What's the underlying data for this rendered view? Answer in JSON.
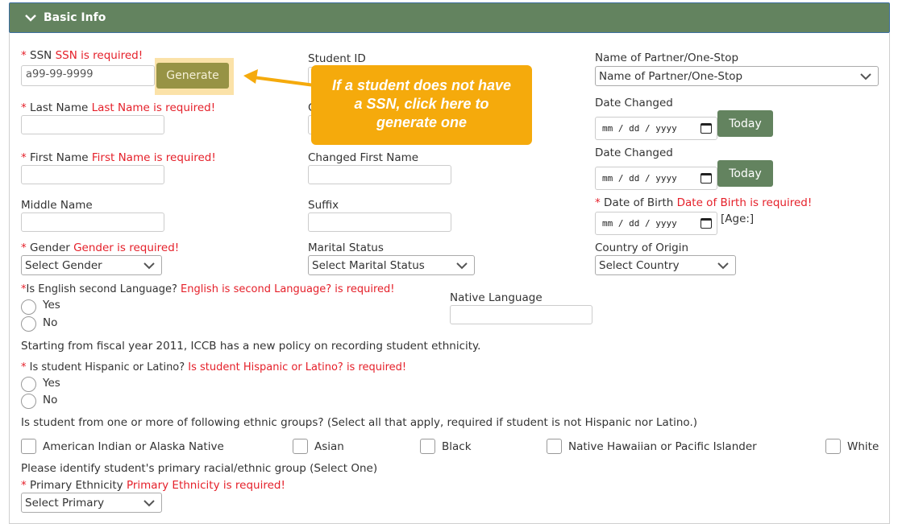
{
  "panel": {
    "title": "Basic Info",
    "icon": "chevron-down-icon"
  },
  "ssn": {
    "star": "* ",
    "label": "SSN ",
    "error": "SSN is required!",
    "value": "a99-99-9999",
    "generate_label": "Generate"
  },
  "callout": {
    "line1": "If a student does not have",
    "line2": "a SSN, click here to",
    "line3": "generate one"
  },
  "student_id": {
    "label": "Student ID",
    "value": ""
  },
  "changed_last_name": {
    "label": "C",
    "value": ""
  },
  "partner": {
    "label": "Name of Partner/One-Stop",
    "selected": "Name of Partner/One-Stop"
  },
  "date_changed_1": {
    "label": "Date Changed",
    "placeholder": "mm / dd / yyyy",
    "today_label": "Today"
  },
  "date_changed_2": {
    "label": "Date Changed",
    "placeholder": "mm / dd / yyyy",
    "today_label": "Today"
  },
  "last_name": {
    "star": "* ",
    "label": "Last Name ",
    "error": "Last Name is required!",
    "value": ""
  },
  "first_name": {
    "star": "* ",
    "label": "First Name ",
    "error": "First Name is required!",
    "value": ""
  },
  "changed_first_name": {
    "label": "Changed First Name",
    "value": ""
  },
  "middle_name": {
    "label": "Middle Name",
    "value": ""
  },
  "suffix": {
    "label": "Suffix",
    "value": ""
  },
  "dob": {
    "star": "* ",
    "label": "Date of Birth ",
    "error": "Date of Birth is required!",
    "placeholder": "mm / dd / yyyy",
    "age": "[Age:]"
  },
  "gender": {
    "star": "* ",
    "label": "Gender ",
    "error": "Gender is required!",
    "selected": "Select Gender"
  },
  "marital": {
    "label": "Marital Status",
    "selected": "Select Marital Status"
  },
  "country": {
    "label": "Country of Origin",
    "selected": "Select Country"
  },
  "esl": {
    "star": "*",
    "label": "Is English second Language? ",
    "error": "English is second Language? is required!",
    "options": [
      "Yes",
      "No"
    ]
  },
  "native_language": {
    "label": "Native Language",
    "value": ""
  },
  "policy_note": "Starting from fiscal year 2011, ICCB has a new policy on recording student ethnicity.",
  "hispanic": {
    "star": "* ",
    "label": "Is student Hispanic or Latino? ",
    "error": "Is student Hispanic or Latino? is required!",
    "options": [
      "Yes",
      "No"
    ]
  },
  "ethnic_groups": {
    "prompt": "Is student from one or more of following ethnic groups? (Select all that apply, required if student is not Hispanic nor Latino.)",
    "options": [
      "American Indian or Alaska Native",
      "Asian",
      "Black",
      "Native Hawaiian or Pacific Islander",
      "White"
    ]
  },
  "primary": {
    "note": "Please identify student's primary racial/ethnic group (Select One)",
    "star": "* ",
    "label": "Primary Ethnicity ",
    "error": "Primary Ethnicity is required!",
    "selected": "Select Primary"
  }
}
